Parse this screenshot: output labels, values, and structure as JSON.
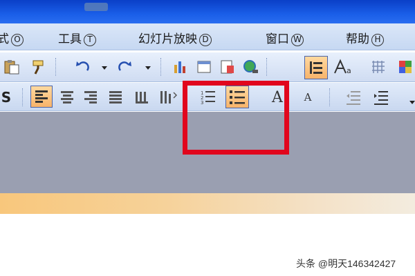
{
  "menu": {
    "items": [
      {
        "label": "式",
        "accel": "O"
      },
      {
        "label": "工具",
        "accel": "T"
      },
      {
        "label": "幻灯片放映",
        "accel": "D"
      },
      {
        "label": "窗口",
        "accel": "W"
      },
      {
        "label": "帮助",
        "accel": "H"
      }
    ]
  },
  "format_toolbar": {
    "bold_short": "S",
    "font_size_letter": "A"
  },
  "watermark": {
    "text": "头条 @明天146342427"
  },
  "colors": {
    "title_bar": "#1a5ee8",
    "menu_bar": "#d2e1f6",
    "toolbar": "#dce7f8",
    "active_button": "#f7b36a",
    "workspace_gray": "#9a9fb1",
    "highlight": "#e1061d"
  }
}
